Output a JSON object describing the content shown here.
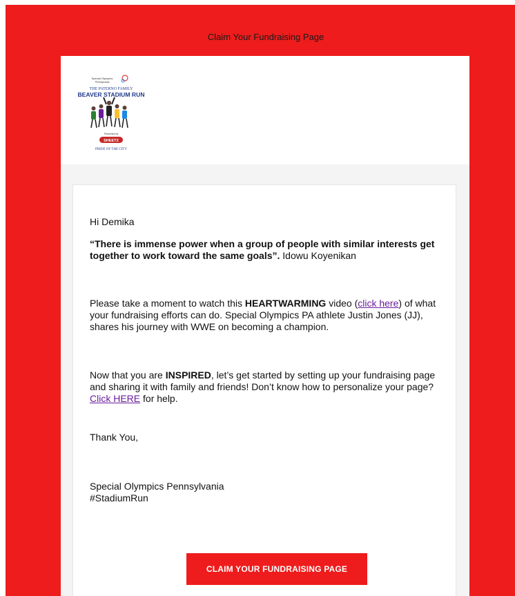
{
  "header": {
    "title": "Claim Your Fundraising Page"
  },
  "logo": {
    "org_line": "Special Olympics",
    "sub_line": "Pennsylvania",
    "family_line": "THE PATERNO FAMILY",
    "event_line": "BEAVER STADIUM RUN",
    "presented_line": "Presented by",
    "sponsor": "SHEETZ",
    "tagline": "PRIDE OF THE CITY"
  },
  "email": {
    "greeting": "Hi Demika",
    "quote": "“There is immense power when a group of people with similar interests get together to work toward the same goals”.",
    "quote_author": " Idowu Koyenikan",
    "p1_before": "Please take a moment to watch this ",
    "p1_emph": "HEARTWARMING",
    "p1_mid": " video (",
    "p1_link": "click here",
    "p1_after": ") of what your fundraising efforts can do. Special Olympics PA athlete Justin Jones (JJ), shares his journey with WWE on becoming a champion.",
    "p2_before": "Now that you are ",
    "p2_emph": "INSPIRED",
    "p2_mid": ", let’s get started by setting up your fundraising page and sharing it with family and friends! Don’t know how to personalize your page? ",
    "p2_link": "Click HERE",
    "p2_after": " for help.",
    "signoff": "Thank You,",
    "sig_name": "Special Olympics Pennsylvania",
    "sig_tag": "#StadiumRun",
    "cta_label": "CLAIM YOUR FUNDRAISING PAGE"
  },
  "colors": {
    "brand_red": "#ee1c1c",
    "link_purple": "#6a1b9a",
    "logo_blue": "#1f3a8a"
  }
}
